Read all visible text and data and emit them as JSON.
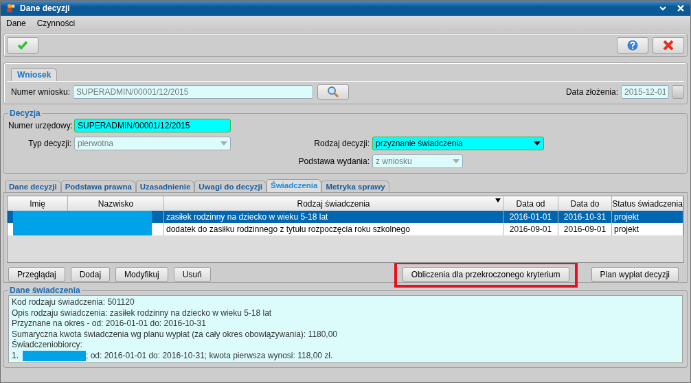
{
  "window": {
    "title": "Dane decyzji"
  },
  "menu": [
    "Dane",
    "Czynności"
  ],
  "application": {
    "tab": "Wniosek",
    "number_label": "Numer wniosku:",
    "number": "SUPERADMIN/00001/12/2015",
    "date_label": "Data złożenia:",
    "date": "2015-12-01"
  },
  "decision": {
    "title": "Decyzja",
    "fields": [
      {
        "label": "Numer urzędowy:",
        "value": "SUPERADMIN/00001/12/2015",
        "kind": "text",
        "disabled": false
      },
      {
        "label": "Typ decyzji:",
        "value": "pierwotna",
        "kind": "select",
        "disabled": true
      },
      {
        "label": "Rodzaj decyzji:",
        "value": "przyznanie świadczenia",
        "kind": "select",
        "disabled": false
      },
      {
        "label": "Podstawa wydania:",
        "value": "z wniosku",
        "kind": "select",
        "disabled": true
      }
    ]
  },
  "tabs": [
    {
      "label": "Dane decyzji",
      "selected": false
    },
    {
      "label": "Podstawa prawna",
      "selected": false
    },
    {
      "label": "Uzasadnienie",
      "selected": false
    },
    {
      "label": "Uwagi do decyzji",
      "selected": false
    },
    {
      "label": "Świadczenia",
      "selected": true
    },
    {
      "label": "Metryka sprawy",
      "selected": false
    }
  ],
  "table": {
    "columns": [
      {
        "label": "Imię",
        "sorted": false
      },
      {
        "label": "Nazwisko",
        "sorted": false
      },
      {
        "label": "Rodzaj świadczenia",
        "sorted": true
      },
      {
        "label": "Data od",
        "sorted": false
      },
      {
        "label": "Data do",
        "sorted": false
      },
      {
        "label": "Status świadczenia",
        "sorted": false
      }
    ],
    "rows": [
      {
        "selected": true,
        "benefit": "zasiłek rodzinny na dziecko w wieku 5-18 lat",
        "from": "2016-01-01",
        "to": "2016-10-31",
        "status": "projekt"
      },
      {
        "selected": false,
        "benefit": "dodatek do zasiłku rodzinnego z tytułu rozpoczęcia roku szkolnego",
        "from": "2016-09-01",
        "to": "2016-09-01",
        "status": "projekt"
      }
    ]
  },
  "buttons_left": [
    "Przeglądaj",
    "Dodaj",
    "Modyfikuj",
    "Usuń"
  ],
  "buttons_right": [
    {
      "label": "Obliczenia dla przekroczonego kryterium",
      "highlighted": true
    },
    {
      "label": "Plan wypłat decyzji",
      "highlighted": false
    }
  ],
  "details": {
    "title": "Dane świadczenia",
    "lines": [
      "Kod rodzaju świadczenia: 501120",
      "Opis rodzaju świadczenia: zasiłek rodzinny na dziecko w wieku 5-18 lat",
      "Przyznane na okres - od: 2016-01-01 do: 2016-10-31",
      "Sumaryczna kwota świadczenia wg planu wypłat (za cały okres obowiązywania): 1180,00",
      "Świadczeniobiorcy:"
    ],
    "beneficiary": {
      "number": "1.",
      "rest": "; od: 2016-01-01 do: 2016-10-31; kwota pierwsza wynosi: 118,00 zł."
    }
  }
}
